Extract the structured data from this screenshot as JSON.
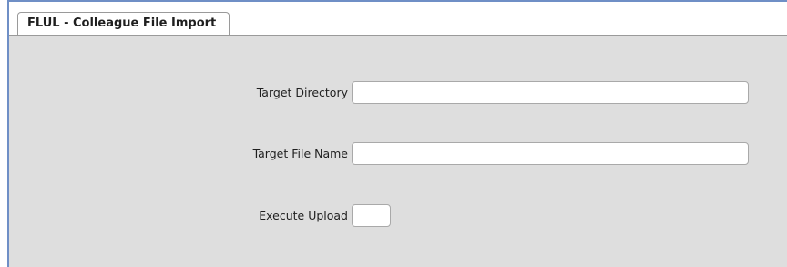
{
  "tab": {
    "label": "FLUL - Colleague File Import"
  },
  "form": {
    "fields": [
      {
        "label": "Target Directory",
        "value": ""
      },
      {
        "label": "Target File Name",
        "value": ""
      },
      {
        "label": "Execute Upload",
        "value": ""
      }
    ]
  },
  "colors": {
    "panel_background": "#dedede",
    "accent_border": "#6f8fc6"
  }
}
